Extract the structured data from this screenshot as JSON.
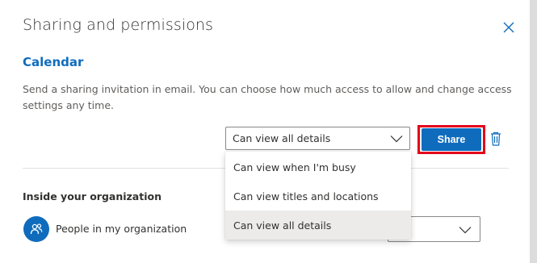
{
  "dialog": {
    "title": "Sharing and permissions",
    "section_title": "Calendar",
    "description": "Send a sharing invitation in email. You can choose how much access to allow and change access settings any time."
  },
  "permission_select": {
    "value": "Can view all details",
    "options": [
      {
        "label": "Can view when I'm busy",
        "selected": false
      },
      {
        "label": "Can view titles and locations",
        "selected": false
      },
      {
        "label": "Can view all details",
        "selected": true
      }
    ]
  },
  "actions": {
    "share_label": "Share"
  },
  "organization": {
    "heading": "Inside your organization",
    "entity_name": "People in my organization"
  },
  "colors": {
    "accent": "#0f6cbd",
    "highlight_outline": "#e3001b",
    "selected_option_bg": "#edebe9"
  },
  "icons": {
    "close": "close-icon",
    "chevron": "chevron-down-icon",
    "delete": "trash-icon",
    "people": "people-icon"
  }
}
